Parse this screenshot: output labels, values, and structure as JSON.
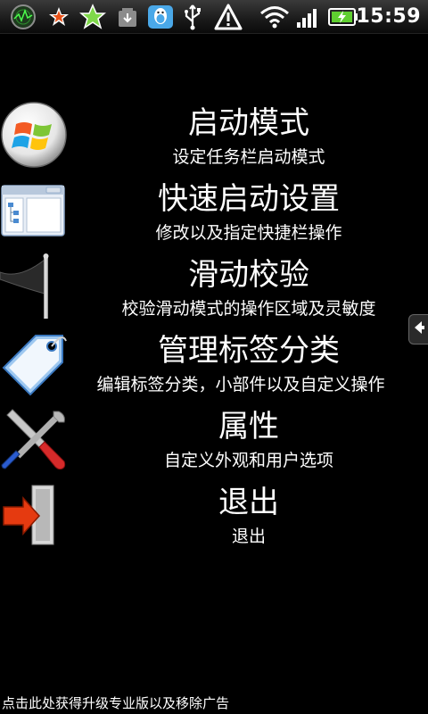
{
  "status_bar": {
    "time": "15:59",
    "icons": [
      "radar-app-icon",
      "star-orange-icon",
      "star-green-icon",
      "download-icon",
      "qq-penguin-icon",
      "usb-icon",
      "warning-icon",
      "wifi-icon",
      "signal-icon",
      "battery-charging-icon"
    ]
  },
  "menu": {
    "items": [
      {
        "title": "启动模式",
        "subtitle": "设定任务栏启动模式",
        "icon": "windows-logo-icon"
      },
      {
        "title": "快速启动设置",
        "subtitle": "修改以及指定快捷栏操作",
        "icon": "window-list-icon"
      },
      {
        "title": "滑动校验",
        "subtitle": "校验滑动模式的操作区域及灵敏度",
        "icon": "flag-icon"
      },
      {
        "title": "管理标签分类",
        "subtitle": "编辑标签分类，小部件以及自定义操作",
        "icon": "tag-icon"
      },
      {
        "title": "属性",
        "subtitle": "自定义外观和用户选项",
        "icon": "tools-icon"
      },
      {
        "title": "退出",
        "subtitle": "退出",
        "icon": "exit-door-icon"
      }
    ]
  },
  "side_handle": {
    "icon": "arrow-left-icon"
  },
  "footer": {
    "ad_text": "点击此处获得升级专业版以及移除广告"
  }
}
